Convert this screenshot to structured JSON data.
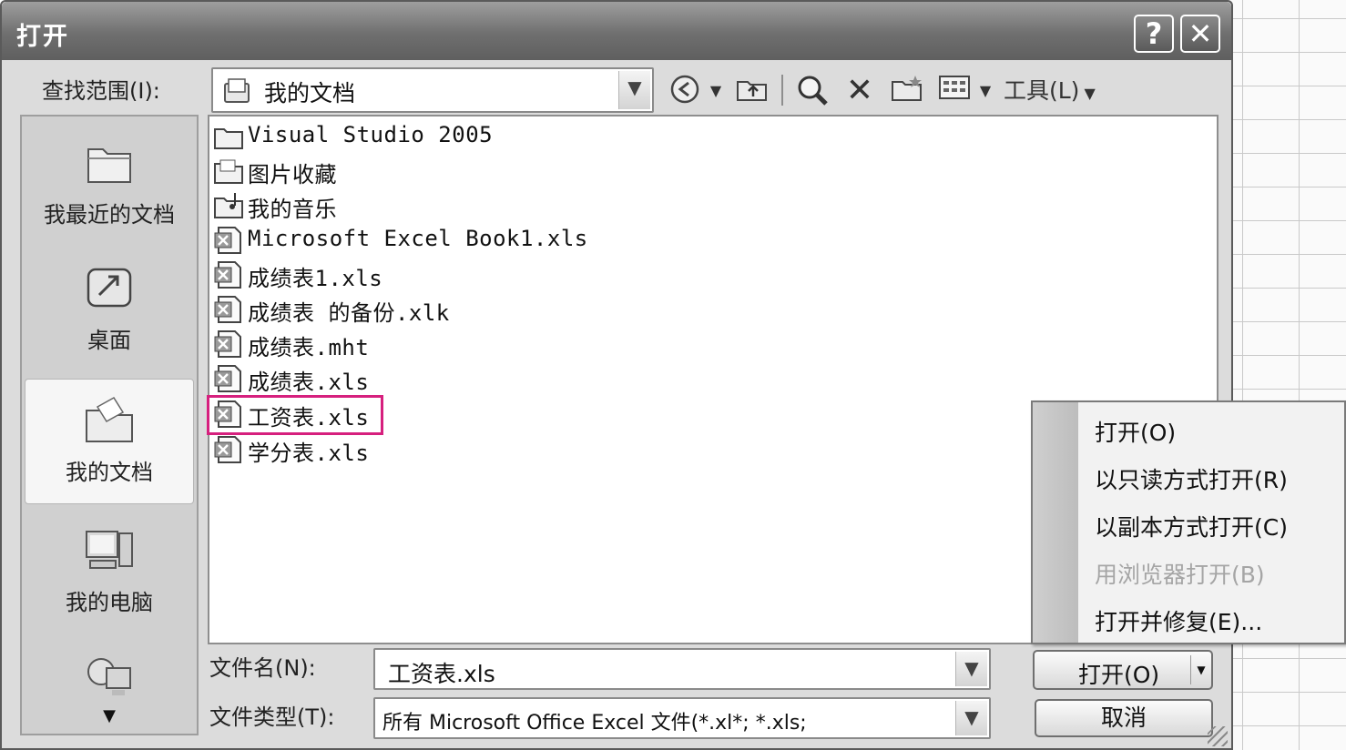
{
  "dialog": {
    "title": "打开",
    "help_button": "?",
    "close_button": "✕"
  },
  "lookin": {
    "label": "查找范围(I):",
    "value": "我的文档"
  },
  "toolbar": {
    "back_icon": "back-icon",
    "up_icon": "up-folder-icon",
    "search_icon": "search-icon",
    "delete_icon": "delete-icon",
    "new_folder_icon": "new-folder-icon",
    "views_icon": "views-icon",
    "tools_label": "工具(L)"
  },
  "places": [
    {
      "label": "我最近的文档",
      "icon": "recent-docs-icon"
    },
    {
      "label": "桌面",
      "icon": "desktop-icon"
    },
    {
      "label": "我的文档",
      "icon": "my-documents-icon",
      "selected": true
    },
    {
      "label": "我的电脑",
      "icon": "my-computer-icon"
    },
    {
      "label": "",
      "icon": "network-places-icon"
    }
  ],
  "files": [
    {
      "name": "Visual Studio 2005",
      "type": "folder"
    },
    {
      "name": "图片收藏",
      "type": "pictures-folder"
    },
    {
      "name": "我的音乐",
      "type": "music-folder"
    },
    {
      "name": "Microsoft Excel Book1.xls",
      "type": "excel"
    },
    {
      "name": "成绩表1.xls",
      "type": "excel"
    },
    {
      "name": "成绩表 的备份.xlk",
      "type": "excel"
    },
    {
      "name": "成绩表.mht",
      "type": "excel"
    },
    {
      "name": "成绩表.xls",
      "type": "excel"
    },
    {
      "name": "工资表.xls",
      "type": "excel",
      "highlighted": true
    },
    {
      "name": "学分表.xls",
      "type": "excel"
    }
  ],
  "filename": {
    "label": "文件名(N):",
    "value": "工资表.xls"
  },
  "filetype": {
    "label": "文件类型(T):",
    "value": "所有 Microsoft Office Excel 文件(*.xl*; *.xls;"
  },
  "buttons": {
    "open": "打开(O)",
    "cancel": "取消"
  },
  "open_menu": [
    {
      "label": "打开(O)",
      "enabled": true
    },
    {
      "label": "以只读方式打开(R)",
      "enabled": true
    },
    {
      "label": "以副本方式打开(C)",
      "enabled": true
    },
    {
      "label": "用浏览器打开(B)",
      "enabled": false
    },
    {
      "label": "打开并修复(E)...",
      "enabled": true
    }
  ],
  "colors": {
    "highlight": "#d6207e",
    "titlebar": "#6f6f6f",
    "dialog_bg": "#dcdcdc"
  }
}
